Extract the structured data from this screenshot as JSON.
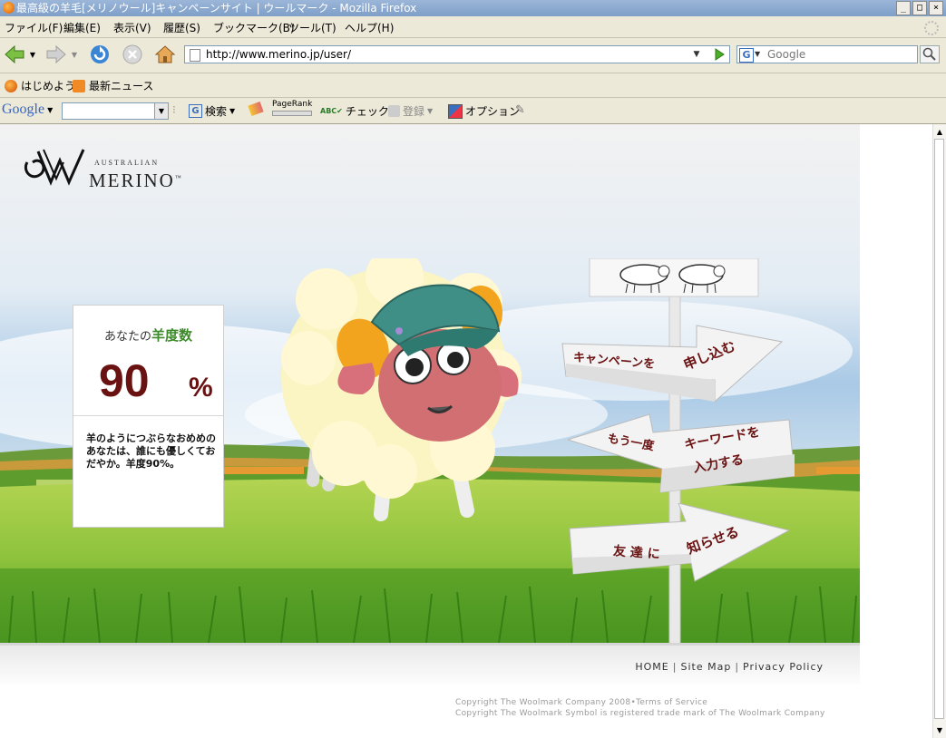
{
  "window": {
    "title": "最高級の羊毛[メリノウール]キャンペーンサイト | ウールマーク - Mozilla Firefox",
    "controls": [
      "_",
      "□",
      "×"
    ]
  },
  "menu": [
    "ファイル(F)",
    "編集(E)",
    "表示(V)",
    "履歴(S)",
    "ブックマーク(B)",
    "ツール(T)",
    "ヘルプ(H)"
  ],
  "navigation": {
    "url": "http://www.merino.jp/user/",
    "search_placeholder": "Google",
    "search_engine_icon": "G"
  },
  "bookmarks": [
    {
      "label": "はじめよう",
      "icon": "firefox-icon"
    },
    {
      "label": "最新ニュース",
      "icon": "rss-icon"
    }
  ],
  "google_toolbar": {
    "brand": "Google",
    "search_label": "検索",
    "pagerank_label": "PageRank",
    "check_label": "チェック",
    "register_label": "登録",
    "options_label": "オプション"
  },
  "page": {
    "logo": {
      "top": "AUSTRALIAN",
      "main": "MERINO",
      "tm": "™"
    },
    "score": {
      "label_prefix": "あなたの",
      "label_highlight": "羊度数",
      "value": "90",
      "unit": "%",
      "description": "羊のようにつぶらなおめめのあなたは、誰にも優しくておだやか。羊度90%。"
    },
    "signpost": {
      "sign1": {
        "left": "キャンペーンを",
        "right": "申し込む"
      },
      "sign2": {
        "left": "もう一度",
        "right1": "キーワードを",
        "right2": "入力する"
      },
      "sign3": {
        "left": "友 達 に",
        "right": "知らせる"
      }
    },
    "footer": {
      "links": [
        "HOME",
        "Site Map",
        "Privacy Policy"
      ],
      "copyright1": "Copyright The Woolmark Company 2008•Terms of Service",
      "copyright2": "Copyright The Woolmark Symbol is registered trade mark of The Woolmark Company"
    }
  },
  "colors": {
    "accent_dark_red": "#6a1212",
    "highlight_green": "#3c8a2a",
    "chrome_bg": "#ece9d8"
  }
}
